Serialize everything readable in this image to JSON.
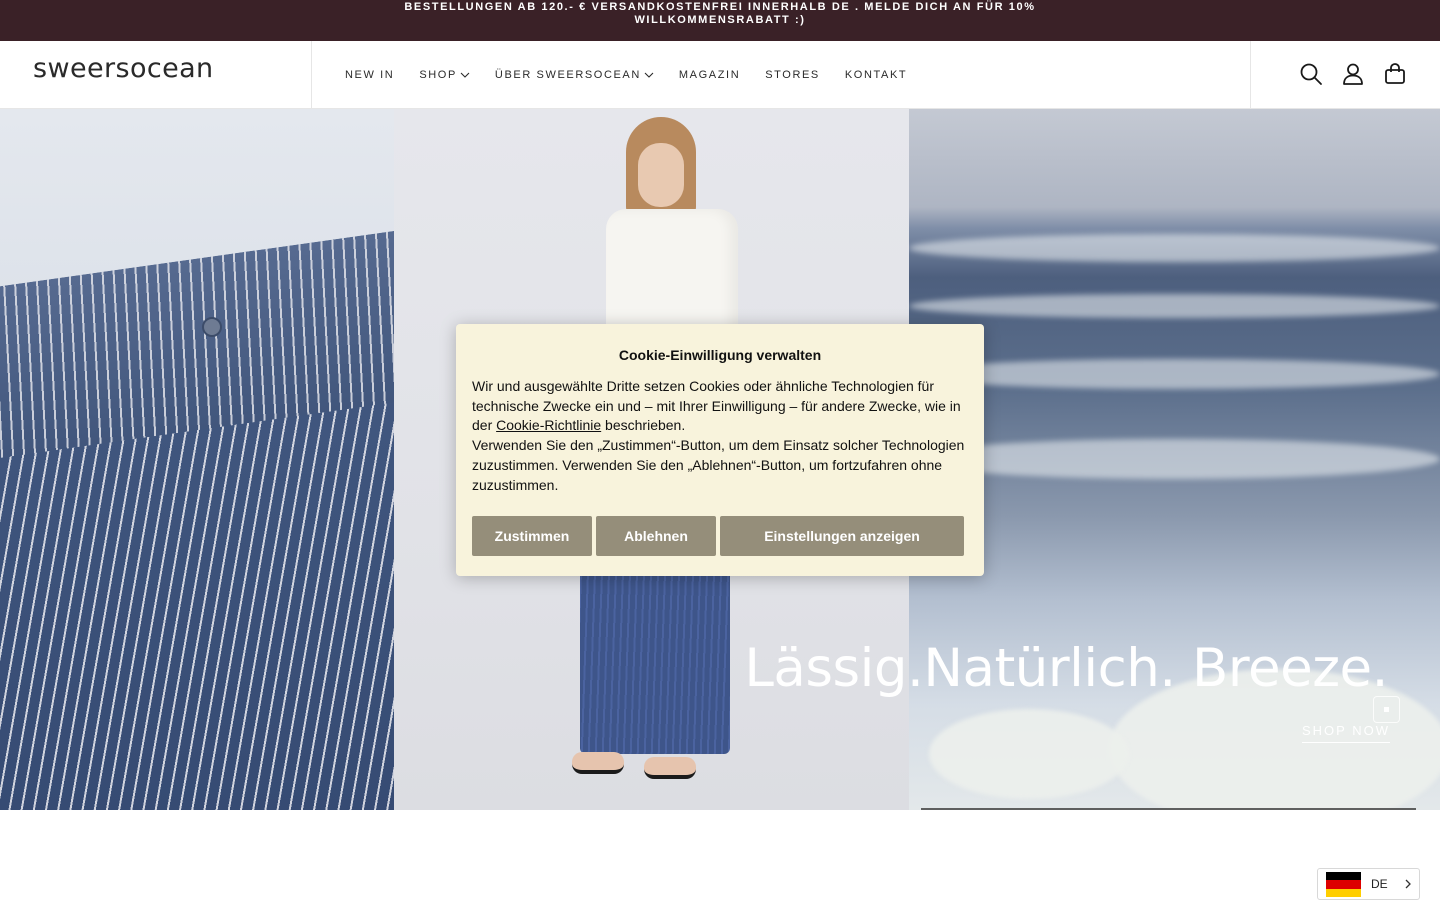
{
  "announcement": {
    "text": "BESTELLUNGEN AB 120.- € VERSANDKOSTENFREI INNERHALB DE . MELDE DICH AN FÜR 10% WILLKOMMENSRABATT :)"
  },
  "header": {
    "logo": "sweersocean",
    "nav": [
      {
        "label": "NEW IN",
        "has_dropdown": false
      },
      {
        "label": "SHOP",
        "has_dropdown": true
      },
      {
        "label": "ÜBER SWEERSOCEAN",
        "has_dropdown": true
      },
      {
        "label": "MAGAZIN",
        "has_dropdown": false
      },
      {
        "label": "STORES",
        "has_dropdown": false
      },
      {
        "label": "KONTAKT",
        "has_dropdown": false
      }
    ],
    "icons": [
      "search-icon",
      "account-icon",
      "cart-icon"
    ]
  },
  "hero": {
    "heading": "Lässig.Natürlich. Breeze.",
    "cta": "SHOP NOW"
  },
  "cookie": {
    "title": "Cookie-Einwilligung verwalten",
    "text_before_link": "Wir und ausgewählte Dritte setzen Cookies oder ähnliche Technologien für technische Zwecke ein und – mit Ihrer Einwilligung – für andere Zwecke, wie in der ",
    "link": "Cookie-Richtlinie",
    "text_after_link": " beschrieben.",
    "text_second": "Verwenden Sie den „Zustimmen“-Button, um dem Einsatz solcher Technologien zuzustimmen. Verwenden Sie den „Ablehnen“-Button, um fortzufahren ohne zuzustimmen.",
    "buttons": {
      "accept": "Zustimmen",
      "reject": "Ablehnen",
      "settings": "Einstellungen anzeigen"
    }
  },
  "language": {
    "code": "DE",
    "flag_colors": [
      "#000000",
      "#dd0000",
      "#ffce00"
    ]
  },
  "colors": {
    "announcement_bg": "#3a2127",
    "cookie_bg": "#f8f3dc",
    "cookie_button": "#958e7a"
  }
}
